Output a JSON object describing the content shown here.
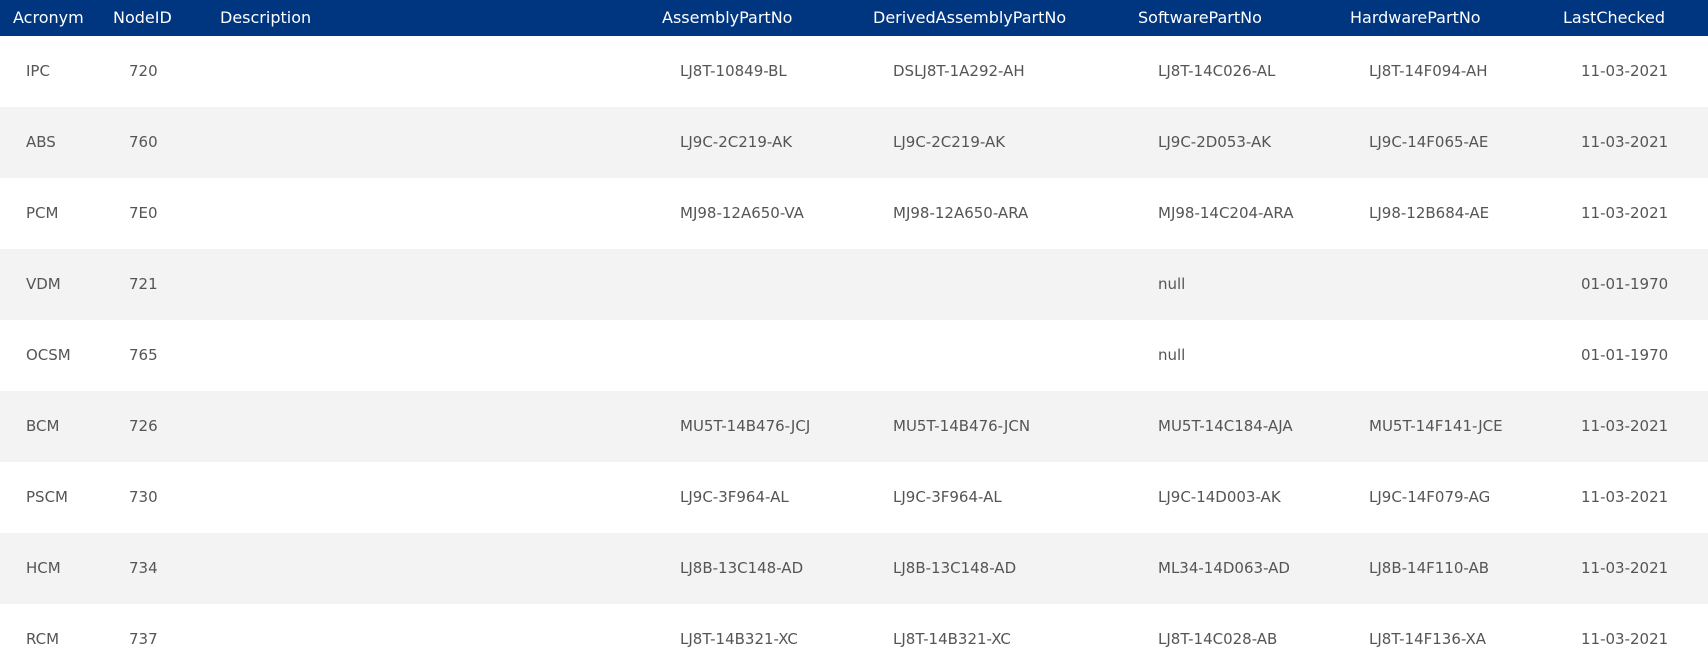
{
  "table": {
    "headers": {
      "acronym": "Acronym",
      "node_id": "NodeID",
      "description": "Description",
      "assembly": "AssemblyPartNo",
      "derived": "DerivedAssemblyPartNo",
      "software": "SoftwarePartNo",
      "hardware": "HardwarePartNo",
      "last_checked": "LastChecked"
    },
    "rows": [
      {
        "acronym": "IPC",
        "node_id": "720",
        "description": "",
        "assembly": "LJ8T-10849-BL",
        "derived": "DSLJ8T-1A292-AH",
        "software": "LJ8T-14C026-AL",
        "hardware": "LJ8T-14F094-AH",
        "last_checked": "11-03-2021"
      },
      {
        "acronym": "ABS",
        "node_id": "760",
        "description": "",
        "assembly": "LJ9C-2C219-AK",
        "derived": "LJ9C-2C219-AK",
        "software": "LJ9C-2D053-AK",
        "hardware": "LJ9C-14F065-AE",
        "last_checked": "11-03-2021"
      },
      {
        "acronym": "PCM",
        "node_id": "7E0",
        "description": "",
        "assembly": "MJ98-12A650-VA",
        "derived": "MJ98-12A650-ARA",
        "software": "MJ98-14C204-ARA",
        "hardware": "LJ98-12B684-AE",
        "last_checked": "11-03-2021"
      },
      {
        "acronym": "VDM",
        "node_id": "721",
        "description": "",
        "assembly": "",
        "derived": "",
        "software": "null",
        "hardware": "",
        "last_checked": "01-01-1970"
      },
      {
        "acronym": "OCSM",
        "node_id": "765",
        "description": "",
        "assembly": "",
        "derived": "",
        "software": "null",
        "hardware": "",
        "last_checked": "01-01-1970"
      },
      {
        "acronym": "BCM",
        "node_id": "726",
        "description": "",
        "assembly": "MU5T-14B476-JCJ",
        "derived": "MU5T-14B476-JCN",
        "software": "MU5T-14C184-AJA",
        "hardware": "MU5T-14F141-JCE",
        "last_checked": "11-03-2021"
      },
      {
        "acronym": "PSCM",
        "node_id": "730",
        "description": "",
        "assembly": "LJ9C-3F964-AL",
        "derived": "LJ9C-3F964-AL",
        "software": "LJ9C-14D003-AK",
        "hardware": "LJ9C-14F079-AG",
        "last_checked": "11-03-2021"
      },
      {
        "acronym": "HCM",
        "node_id": "734",
        "description": "",
        "assembly": "LJ8B-13C148-AD",
        "derived": "LJ8B-13C148-AD",
        "software": "ML34-14D063-AD",
        "hardware": "LJ8B-14F110-AB",
        "last_checked": "11-03-2021"
      },
      {
        "acronym": "RCM",
        "node_id": "737",
        "description": "",
        "assembly": "LJ8T-14B321-XC",
        "derived": "LJ8T-14B321-XC",
        "software": "LJ8T-14C028-AB",
        "hardware": "LJ8T-14F136-XA",
        "last_checked": "11-03-2021"
      }
    ],
    "colors": {
      "header_bg": "#003580",
      "header_text": "#ffffff",
      "row_alt_bg": "#f3f3f3",
      "cell_text": "#555555"
    }
  }
}
